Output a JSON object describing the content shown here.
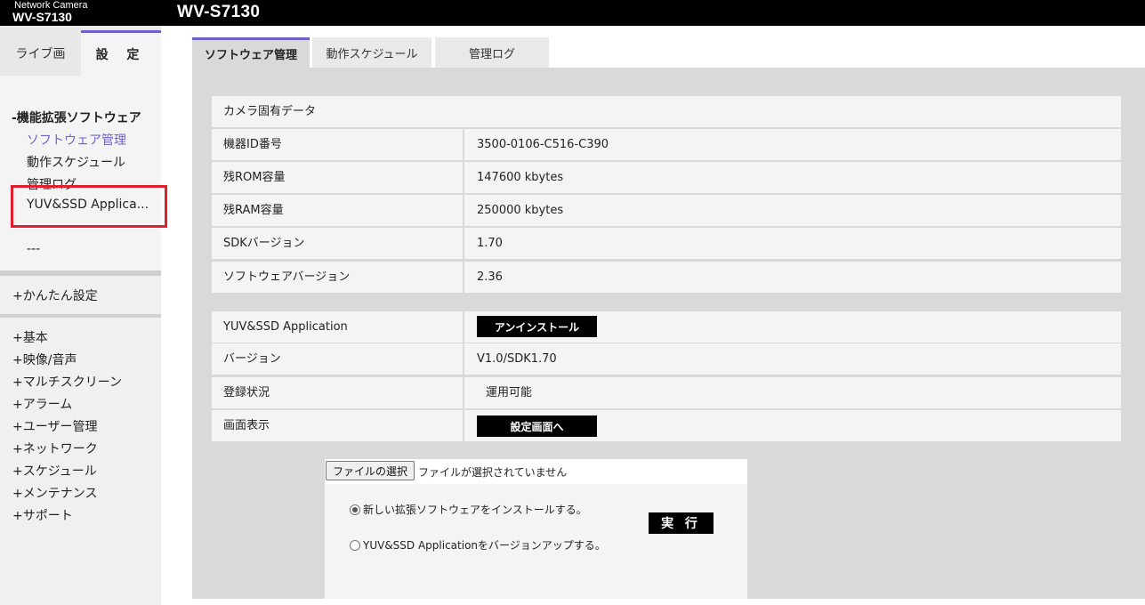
{
  "header": {
    "brand_line1": "Network Camera",
    "brand_line2": "WV-S7130",
    "title": "WV-S7130"
  },
  "mode_tabs": {
    "live": "ライブ画",
    "setup": "設 定"
  },
  "sidebar": {
    "ext_section": "-機能拡張ソフトウェア",
    "ext_items": [
      "ソフトウェア管理",
      "動作スケジュール",
      "管理ログ",
      "YUV&SSD Applica...",
      "---",
      "---"
    ],
    "easy_setup": "+かんたん設定",
    "menu": [
      "+基本",
      "+映像/音声",
      "+マルチスクリーン",
      "+アラーム",
      "+ユーザー管理",
      "+ネットワーク",
      "+スケジュール",
      "+メンテナンス",
      "+サポート"
    ]
  },
  "content_tabs": [
    "ソフトウェア管理",
    "動作スケジュール",
    "管理ログ"
  ],
  "camera_data": {
    "heading": "カメラ固有データ",
    "rows": [
      {
        "label": "機器ID番号",
        "value": "3500-0106-C516-C390"
      },
      {
        "label": "残ROM容量",
        "value": "147600 kbytes"
      },
      {
        "label": "残RAM容量",
        "value": "250000 kbytes"
      },
      {
        "label": "SDKバージョン",
        "value": "1.70"
      },
      {
        "label": "ソフトウェアバージョン",
        "value": "2.36"
      }
    ]
  },
  "app": {
    "name": "YUV&SSD Application",
    "uninstall_label": "アンインストール",
    "version_label": "バージョン",
    "version_value": "V1.0/SDK1.70",
    "status_label": "登録状況",
    "status_value": "運用可能",
    "display_label": "画面表示",
    "settings_button": "設定画面へ"
  },
  "install": {
    "file_button": "ファイルの選択",
    "file_status": "ファイルが選択されていません",
    "option_new": "新しい拡張ソフトウェアをインストールする。",
    "option_upgrade": "YUV&SSD Applicationをバージョンアップする。",
    "execute_label": "実 行",
    "selected_option": "new"
  },
  "colors": {
    "accent": "#6b63c9",
    "highlight": "#e0202a"
  }
}
